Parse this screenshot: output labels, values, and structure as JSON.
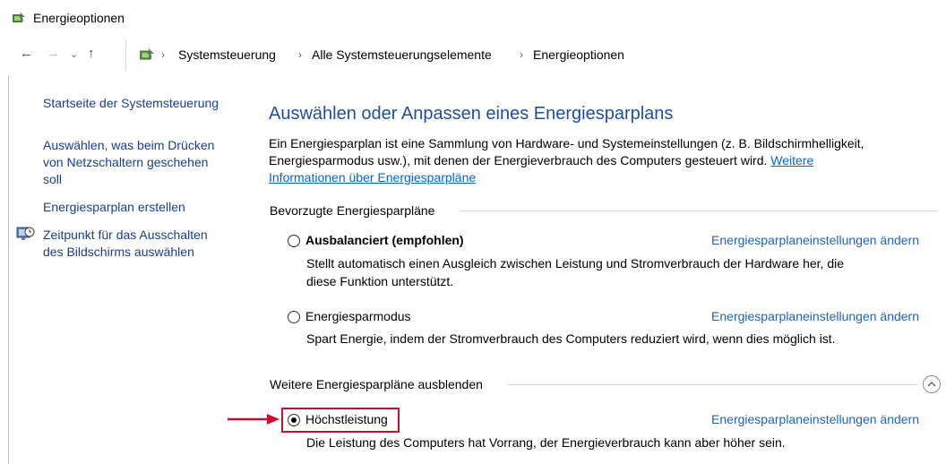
{
  "window": {
    "title": "Energieoptionen",
    "icon": "power-options-icon"
  },
  "nav": {
    "back_icon": "back-arrow-icon",
    "forward_icon": "forward-arrow-icon",
    "recent_icon": "chevron-down-icon",
    "up_icon": "up-arrow-icon",
    "breadcrumbs": [
      "Systemsteuerung",
      "Alle Systemsteuerungselemente",
      "Energieoptionen"
    ]
  },
  "sidebar": {
    "items": [
      {
        "label": "Startseite der Systemsteuerung"
      },
      {
        "label_lines": [
          "Auswählen, was beim Drücken",
          "von Netzschaltern geschehen",
          "soll"
        ]
      },
      {
        "label": "Energiesparplan erstellen"
      },
      {
        "label_lines": [
          "Zeitpunkt für das Ausschalten",
          "des Bildschirms auswählen"
        ],
        "icon": "display-clock-icon"
      }
    ]
  },
  "main": {
    "title": "Auswählen oder Anpassen eines Energiesparplans",
    "description_line1": "Ein Energiesparplan ist eine Sammlung von Hardware- und Systemeinstellungen (z. B. Bildschirmhelligkeit,",
    "description_line2": "Energiesparmodus usw.), mit denen der Energieverbrauch des Computers gesteuert wird.",
    "description_link_part1": "Weitere",
    "description_link_part2": "Informationen über Energiesparpläne",
    "preferred_heading": "Bevorzugte Energiesparpläne",
    "more_heading": "Weitere Energiesparpläne ausblenden",
    "plans": [
      {
        "name": "Ausbalanciert (empfohlen)",
        "selected": false,
        "desc_lines": [
          "Stellt automatisch einen Ausgleich zwischen Leistung und Stromverbrauch der Hardware her, die",
          "diese Funktion unterstützt."
        ],
        "link": "Energiesparplaneinstellungen ändern"
      },
      {
        "name": "Energiesparmodus",
        "selected": false,
        "desc_lines": [
          "Spart Energie, indem der Stromverbrauch des Computers reduziert wird, wenn dies möglich ist."
        ],
        "link": "Energiesparplaneinstellungen ändern"
      },
      {
        "name": "Höchstleistung",
        "selected": true,
        "desc_lines": [
          "Die Leistung des Computers hat Vorrang, der Energieverbrauch kann aber höher sein."
        ],
        "link": "Energiesparplaneinstellungen ändern"
      }
    ]
  },
  "colors": {
    "link": "#1e64b4",
    "title": "#1e4e9e",
    "highlight": "#c8102e"
  }
}
